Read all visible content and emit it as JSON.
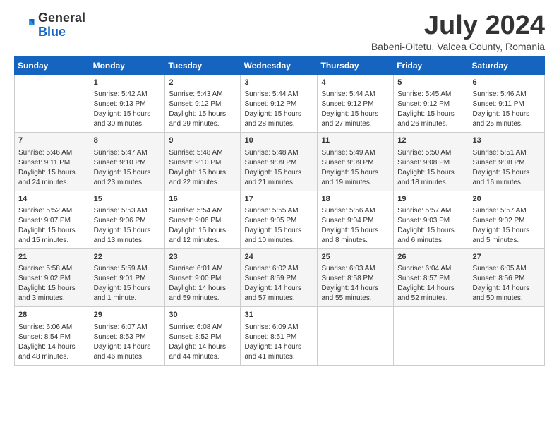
{
  "header": {
    "logo_general": "General",
    "logo_blue": "Blue",
    "month_title": "July 2024",
    "subtitle": "Babeni-Oltetu, Valcea County, Romania"
  },
  "days_of_week": [
    "Sunday",
    "Monday",
    "Tuesday",
    "Wednesday",
    "Thursday",
    "Friday",
    "Saturday"
  ],
  "weeks": [
    [
      {
        "day": "",
        "text": ""
      },
      {
        "day": "1",
        "text": "Sunrise: 5:42 AM\nSunset: 9:13 PM\nDaylight: 15 hours\nand 30 minutes."
      },
      {
        "day": "2",
        "text": "Sunrise: 5:43 AM\nSunset: 9:12 PM\nDaylight: 15 hours\nand 29 minutes."
      },
      {
        "day": "3",
        "text": "Sunrise: 5:44 AM\nSunset: 9:12 PM\nDaylight: 15 hours\nand 28 minutes."
      },
      {
        "day": "4",
        "text": "Sunrise: 5:44 AM\nSunset: 9:12 PM\nDaylight: 15 hours\nand 27 minutes."
      },
      {
        "day": "5",
        "text": "Sunrise: 5:45 AM\nSunset: 9:12 PM\nDaylight: 15 hours\nand 26 minutes."
      },
      {
        "day": "6",
        "text": "Sunrise: 5:46 AM\nSunset: 9:11 PM\nDaylight: 15 hours\nand 25 minutes."
      }
    ],
    [
      {
        "day": "7",
        "text": "Sunrise: 5:46 AM\nSunset: 9:11 PM\nDaylight: 15 hours\nand 24 minutes."
      },
      {
        "day": "8",
        "text": "Sunrise: 5:47 AM\nSunset: 9:10 PM\nDaylight: 15 hours\nand 23 minutes."
      },
      {
        "day": "9",
        "text": "Sunrise: 5:48 AM\nSunset: 9:10 PM\nDaylight: 15 hours\nand 22 minutes."
      },
      {
        "day": "10",
        "text": "Sunrise: 5:48 AM\nSunset: 9:09 PM\nDaylight: 15 hours\nand 21 minutes."
      },
      {
        "day": "11",
        "text": "Sunrise: 5:49 AM\nSunset: 9:09 PM\nDaylight: 15 hours\nand 19 minutes."
      },
      {
        "day": "12",
        "text": "Sunrise: 5:50 AM\nSunset: 9:08 PM\nDaylight: 15 hours\nand 18 minutes."
      },
      {
        "day": "13",
        "text": "Sunrise: 5:51 AM\nSunset: 9:08 PM\nDaylight: 15 hours\nand 16 minutes."
      }
    ],
    [
      {
        "day": "14",
        "text": "Sunrise: 5:52 AM\nSunset: 9:07 PM\nDaylight: 15 hours\nand 15 minutes."
      },
      {
        "day": "15",
        "text": "Sunrise: 5:53 AM\nSunset: 9:06 PM\nDaylight: 15 hours\nand 13 minutes."
      },
      {
        "day": "16",
        "text": "Sunrise: 5:54 AM\nSunset: 9:06 PM\nDaylight: 15 hours\nand 12 minutes."
      },
      {
        "day": "17",
        "text": "Sunrise: 5:55 AM\nSunset: 9:05 PM\nDaylight: 15 hours\nand 10 minutes."
      },
      {
        "day": "18",
        "text": "Sunrise: 5:56 AM\nSunset: 9:04 PM\nDaylight: 15 hours\nand 8 minutes."
      },
      {
        "day": "19",
        "text": "Sunrise: 5:57 AM\nSunset: 9:03 PM\nDaylight: 15 hours\nand 6 minutes."
      },
      {
        "day": "20",
        "text": "Sunrise: 5:57 AM\nSunset: 9:02 PM\nDaylight: 15 hours\nand 5 minutes."
      }
    ],
    [
      {
        "day": "21",
        "text": "Sunrise: 5:58 AM\nSunset: 9:02 PM\nDaylight: 15 hours\nand 3 minutes."
      },
      {
        "day": "22",
        "text": "Sunrise: 5:59 AM\nSunset: 9:01 PM\nDaylight: 15 hours\nand 1 minute."
      },
      {
        "day": "23",
        "text": "Sunrise: 6:01 AM\nSunset: 9:00 PM\nDaylight: 14 hours\nand 59 minutes."
      },
      {
        "day": "24",
        "text": "Sunrise: 6:02 AM\nSunset: 8:59 PM\nDaylight: 14 hours\nand 57 minutes."
      },
      {
        "day": "25",
        "text": "Sunrise: 6:03 AM\nSunset: 8:58 PM\nDaylight: 14 hours\nand 55 minutes."
      },
      {
        "day": "26",
        "text": "Sunrise: 6:04 AM\nSunset: 8:57 PM\nDaylight: 14 hours\nand 52 minutes."
      },
      {
        "day": "27",
        "text": "Sunrise: 6:05 AM\nSunset: 8:56 PM\nDaylight: 14 hours\nand 50 minutes."
      }
    ],
    [
      {
        "day": "28",
        "text": "Sunrise: 6:06 AM\nSunset: 8:54 PM\nDaylight: 14 hours\nand 48 minutes."
      },
      {
        "day": "29",
        "text": "Sunrise: 6:07 AM\nSunset: 8:53 PM\nDaylight: 14 hours\nand 46 minutes."
      },
      {
        "day": "30",
        "text": "Sunrise: 6:08 AM\nSunset: 8:52 PM\nDaylight: 14 hours\nand 44 minutes."
      },
      {
        "day": "31",
        "text": "Sunrise: 6:09 AM\nSunset: 8:51 PM\nDaylight: 14 hours\nand 41 minutes."
      },
      {
        "day": "",
        "text": ""
      },
      {
        "day": "",
        "text": ""
      },
      {
        "day": "",
        "text": ""
      }
    ]
  ]
}
